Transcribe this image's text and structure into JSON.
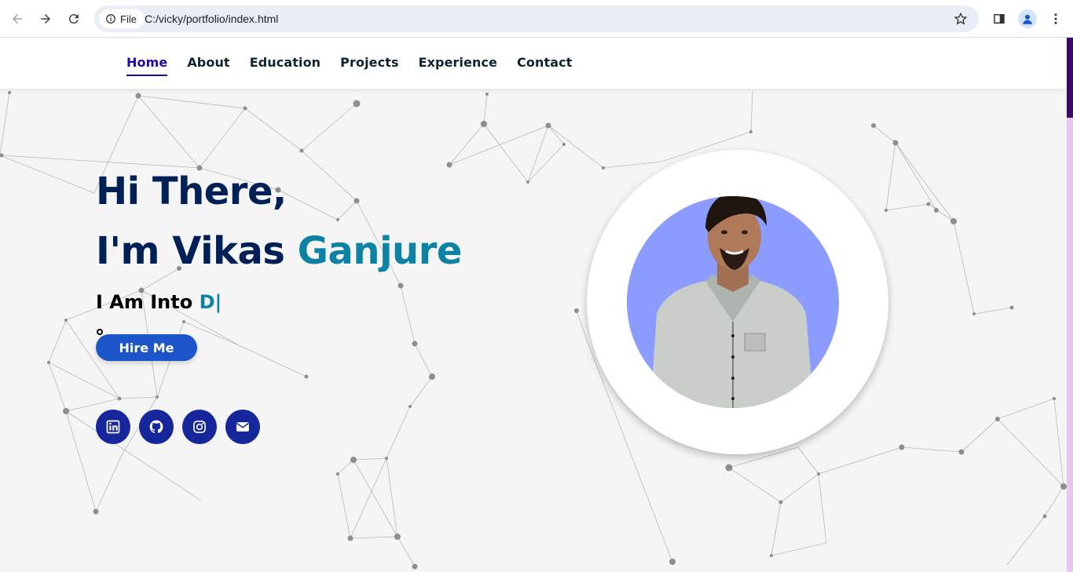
{
  "browser": {
    "site_chip_label": "File",
    "url": "C:/vicky/portfolio/index.html",
    "icons": [
      "back-icon",
      "forward-icon",
      "reload-icon",
      "info-icon",
      "star-icon",
      "side-panel-icon",
      "profile-icon",
      "more-icon"
    ]
  },
  "nav": {
    "items": [
      {
        "label": "Home",
        "active": true
      },
      {
        "label": "About"
      },
      {
        "label": "Education"
      },
      {
        "label": "Projects"
      },
      {
        "label": "Experience"
      },
      {
        "label": "Contact"
      }
    ]
  },
  "hero": {
    "greeting": "Hi There,",
    "intro": "I'm Vikas ",
    "name_accent": "Ganjure",
    "into_prefix": "I Am Into ",
    "typed_text": "D|",
    "hire_button": "Hire Me"
  },
  "socials": {
    "icons": [
      "linkedin-icon",
      "github-icon",
      "instagram-icon",
      "envelope-icon"
    ]
  },
  "colors": {
    "heading": "#002057",
    "accent": "#0c83a4",
    "nav_active": "#2506ad",
    "button": "#1c55c9",
    "social_bg": "#15279b",
    "photo_bg": "#8c9cff",
    "scrollbar_thumb": "#3b0a66"
  }
}
